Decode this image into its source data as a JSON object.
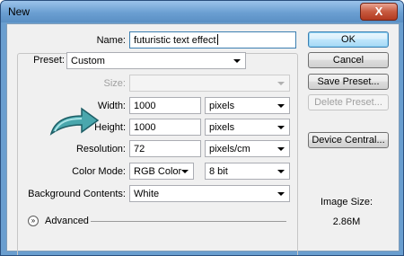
{
  "window": {
    "title": "New",
    "close_label": "X"
  },
  "name": {
    "label": "Name:",
    "value": "futuristic text effect"
  },
  "preset": {
    "label": "Preset:",
    "value": "Custom"
  },
  "size": {
    "label": "Size:",
    "value": ""
  },
  "width": {
    "label": "Width:",
    "value": "1000",
    "unit": "pixels"
  },
  "height": {
    "label": "Height:",
    "value": "1000",
    "unit": "pixels"
  },
  "resolution": {
    "label": "Resolution:",
    "value": "72",
    "unit": "pixels/cm"
  },
  "color_mode": {
    "label": "Color Mode:",
    "value": "RGB Color",
    "depth": "8 bit"
  },
  "background": {
    "label": "Background Contents:",
    "value": "White"
  },
  "advanced": {
    "label": "Advanced",
    "icon": "chevron-double-down-icon"
  },
  "buttons": {
    "ok": "OK",
    "cancel": "Cancel",
    "save_preset": "Save Preset...",
    "delete_preset": "Delete Preset...",
    "device_central": "Device Central..."
  },
  "image_size": {
    "label": "Image Size:",
    "value": "2.86M"
  },
  "colors": {
    "title_bar": "#6b9fd2",
    "annotation_arrow": "#3f9aa0"
  }
}
